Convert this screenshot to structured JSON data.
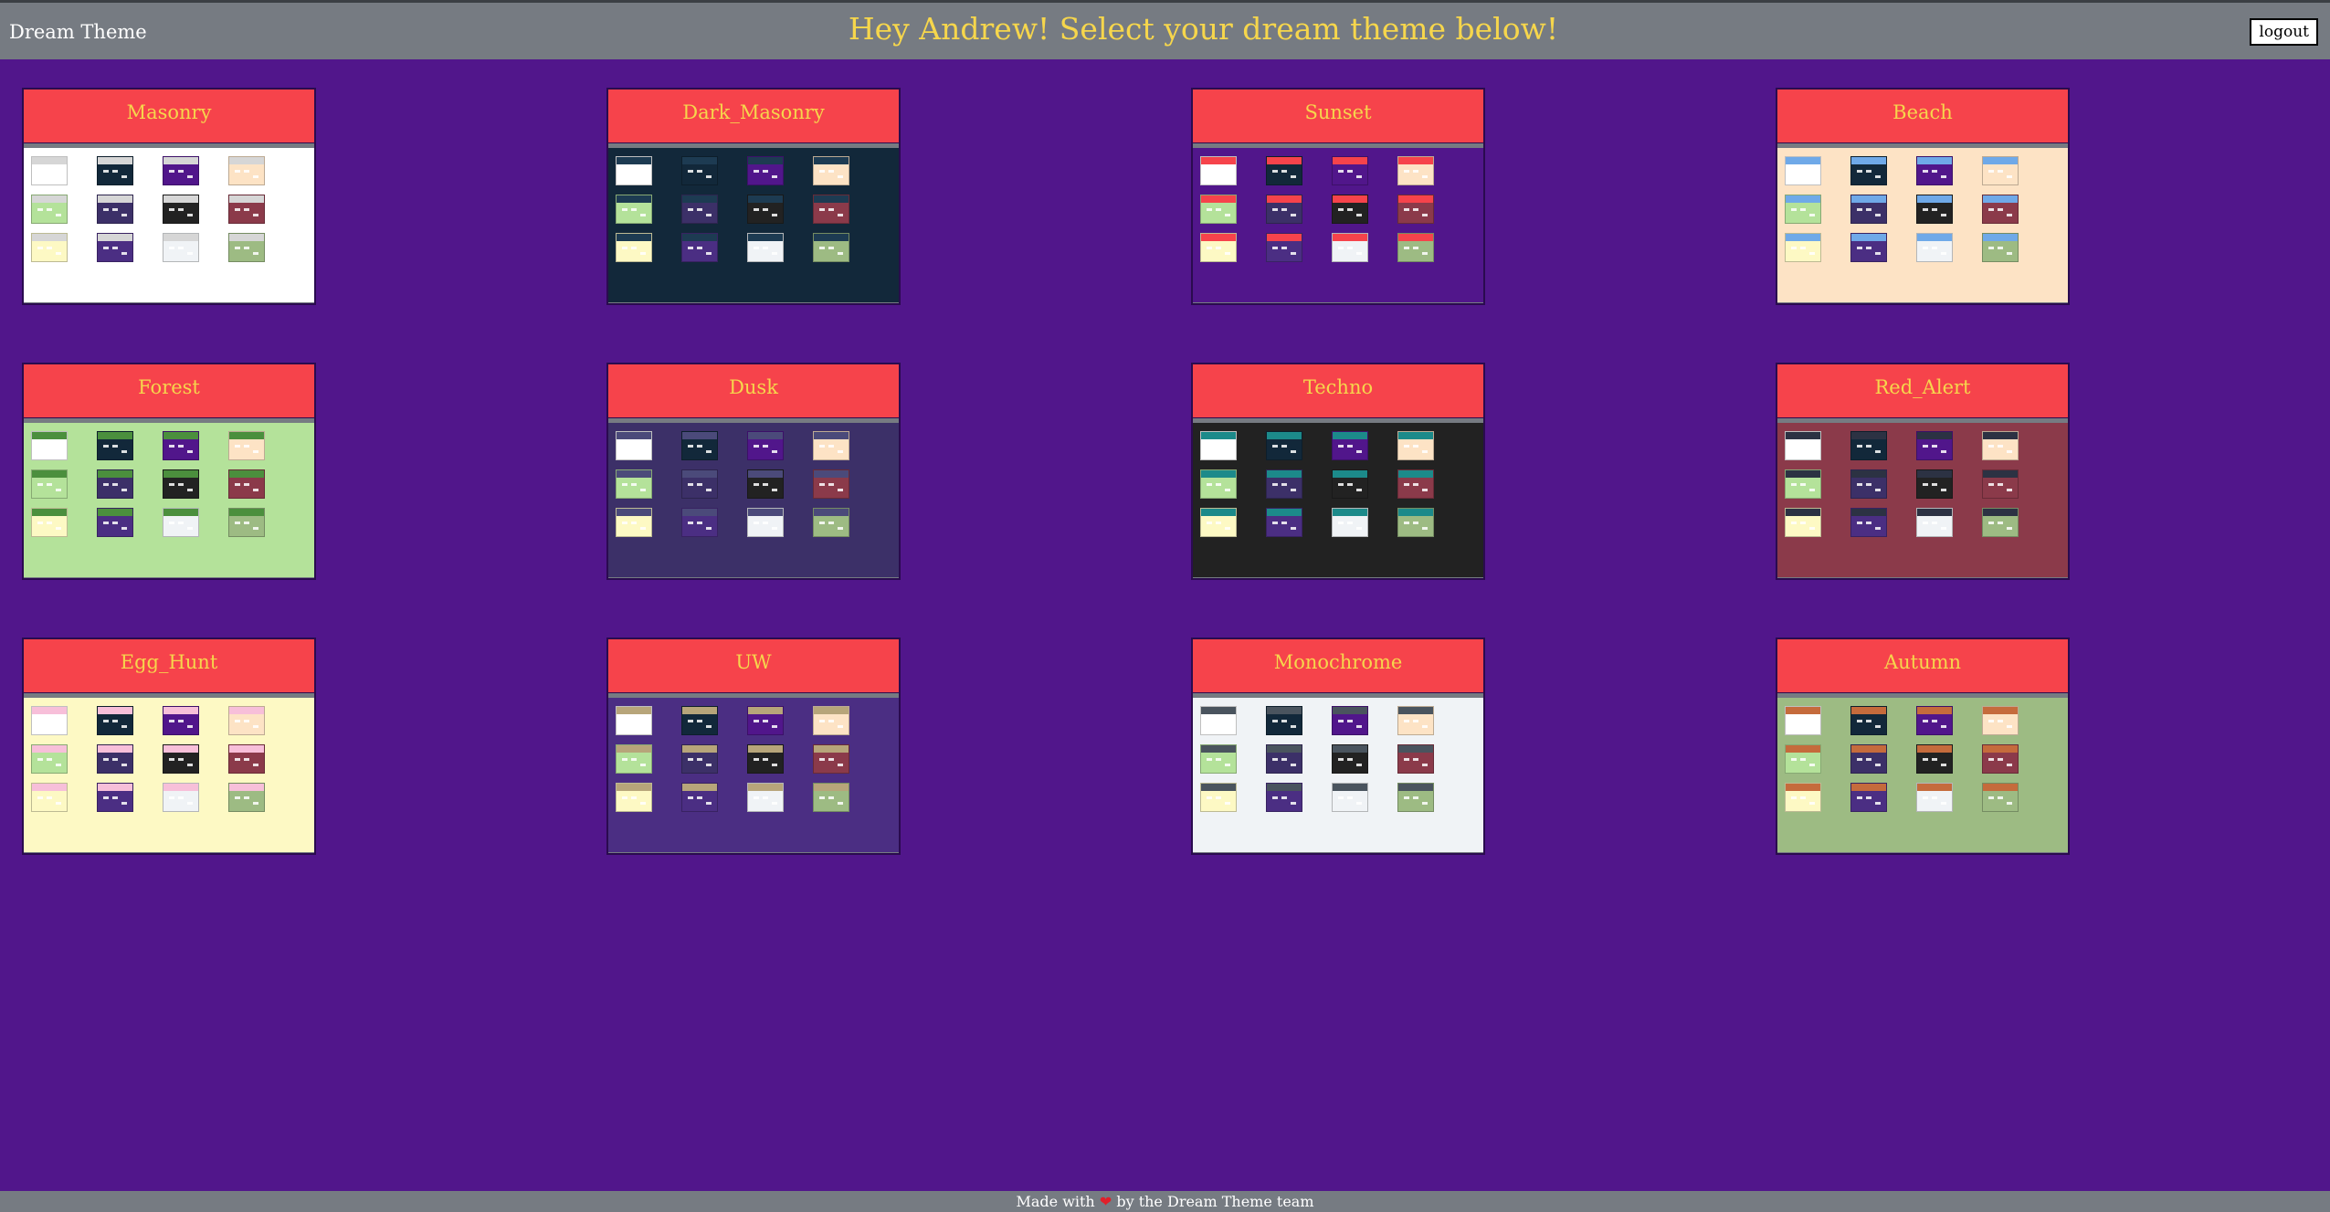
{
  "header": {
    "brand": "Dream Theme",
    "greeting": "Hey Andrew! Select your dream theme below!",
    "logout_label": "logout"
  },
  "themes": [
    {
      "name": "Masonry",
      "bg": "#ffffff",
      "hdr": "#d6d6d6"
    },
    {
      "name": "Dark_Masonry",
      "bg": "#12283a",
      "hdr": "#1d3b52"
    },
    {
      "name": "Sunset",
      "bg": "#51168b",
      "hdr": "#f6434b"
    },
    {
      "name": "Beach",
      "bg": "#fde3c5",
      "hdr": "#6fa9e8"
    },
    {
      "name": "Forest",
      "bg": "#b4e29a",
      "hdr": "#4b8f3d"
    },
    {
      "name": "Dusk",
      "bg": "#3c3068",
      "hdr": "#4b4a7a"
    },
    {
      "name": "Techno",
      "bg": "#222222",
      "hdr": "#1c8a8a"
    },
    {
      "name": "Red_Alert",
      "bg": "#8b3a4a",
      "hdr": "#2c3243"
    },
    {
      "name": "Egg_Hunt",
      "bg": "#fdf9c4",
      "hdr": "#f7bfd9"
    },
    {
      "name": "UW",
      "bg": "#4b2e83",
      "hdr": "#b7a57a"
    },
    {
      "name": "Monochrome",
      "bg": "#f0f3f6",
      "hdr": "#4a545e"
    },
    {
      "name": "Autumn",
      "bg": "#9dbb83",
      "hdr": "#c56b3c"
    }
  ],
  "preview_tiles": [
    "#ffffff",
    "#12283a",
    "#51168b",
    "#fde3c5",
    "#b4e29a",
    "#3c3068",
    "#222222",
    "#8b3a4a",
    "#fdf9c4",
    "#4b2e83",
    "#f0f3f6",
    "#9dbb83"
  ],
  "footer": {
    "before": "Made with",
    "heart": "❤",
    "after": "by the Dream Theme team"
  }
}
